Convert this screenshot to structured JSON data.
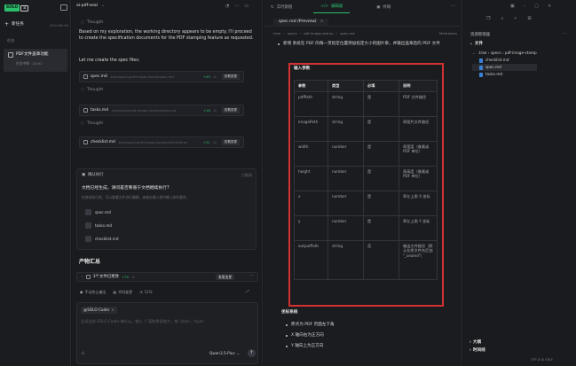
{
  "sidebar": {
    "logo_text": "SOLO",
    "logo_badge": "⌘",
    "new_task": "新任务",
    "new_task_shortcut": "Ctrl+Alt+N",
    "tasks_label": "任务",
    "task_title": "PDF文件盖章功能",
    "task_status": "任务中断 · 20:02"
  },
  "chat": {
    "title": "ai-pdf-seal",
    "thought1": "Thought",
    "paragraph": "Based on my exploration, the working directory appears to be empty. I'll proceed to create the specification documents for the PDF stamping feature as requested.",
    "lets_create": "Let me create the spec files:",
    "files": [
      {
        "name": "spec.md",
        "path": ".trae\\specs\\pdf-image-stamp\\spec.md",
        "add": "+49",
        "del": "-0",
        "btn": "查看变更"
      },
      {
        "name": "tasks.md",
        "path": ".trae\\specs\\pdf-image-stamp\\tasks.md",
        "add": "+18",
        "del": "-0",
        "btn": "查看变更"
      },
      {
        "name": "checklist.md",
        "path": ".trae\\specs\\pdf-image-stamp\\checklist.md",
        "add": "+21",
        "del": "-0",
        "btn": "查看变更"
      }
    ],
    "thought2": "Thought",
    "thought3": "Thought",
    "confirm_label": "确认执行",
    "confirm_status": "已取消",
    "question": "文档已经生成，请问是否要基于文档继续执行?",
    "question_sub": "在继续执行前，可以查看文件进行编辑，或者在输入框中输入你的要求。",
    "confirm_files": [
      "spec.md",
      "tasks.md",
      "checklist.md"
    ],
    "summary_title": "产物汇总",
    "changes_text": "3个文件已更改",
    "changes_add": "+79",
    "changes_del": "-0",
    "changes_btn": "查看变更",
    "auto_run": "手动终止编出",
    "code_changes": "代码变更",
    "progress": "11%",
    "agent": "@SOLO Coder",
    "placeholder": "告诉当前 SOLO Coder 做什么，输入 '/' 获取更多能力，按 '/plan', '/spec'",
    "model": "Qwen3.5-Plus"
  },
  "editor": {
    "tab1": "实时跟随",
    "tab2": "编辑器",
    "tab3": "终端",
    "file_tab": "spec.md (Preview)",
    "crumbs": [
      ".trae",
      "specs",
      "pdf-image-stamp",
      "spec.md"
    ],
    "markdown_label": "Markdown",
    "top_bullet": "新增 系统在 PDF 的每一页指定位置添加指定大小的图片章，并输出盖章后的 PDF 文件",
    "input_title": "输入参数",
    "headers": [
      "参数",
      "类型",
      "必填",
      "说明"
    ],
    "rows": [
      [
        "pdfPath",
        "string",
        "是",
        "PDF 文件路径"
      ],
      [
        "imagePath",
        "string",
        "是",
        "章图片文件路径"
      ],
      [
        "width",
        "number",
        "是",
        "章宽度（像素或 PDF 单位）"
      ],
      [
        "height",
        "number",
        "是",
        "章高度（像素或 PDF 单位）"
      ],
      [
        "x",
        "number",
        "是",
        "章左上角 X 坐标"
      ],
      [
        "y",
        "number",
        "是",
        "章左上角 Y 坐标"
      ],
      [
        "outputPath",
        "string",
        "否",
        "输出文件路径（默认在原文件名后加 \"_sealed\"）"
      ]
    ],
    "coord_title": "坐标系统",
    "coord_items": [
      "原点为 PDF 页面左下角",
      "X 轴向右为正方向",
      "Y 轴向上为正方向"
    ]
  },
  "explorer": {
    "title": "资源管理器",
    "section": "文件",
    "path": ".trae › specs › pdf-image-stamp",
    "files": [
      "checklist.md",
      "spec.md",
      "tasks.md"
    ],
    "outline": "大纲",
    "timeline": "时间线",
    "status": "UTF-8 ⚙ CRLF"
  }
}
